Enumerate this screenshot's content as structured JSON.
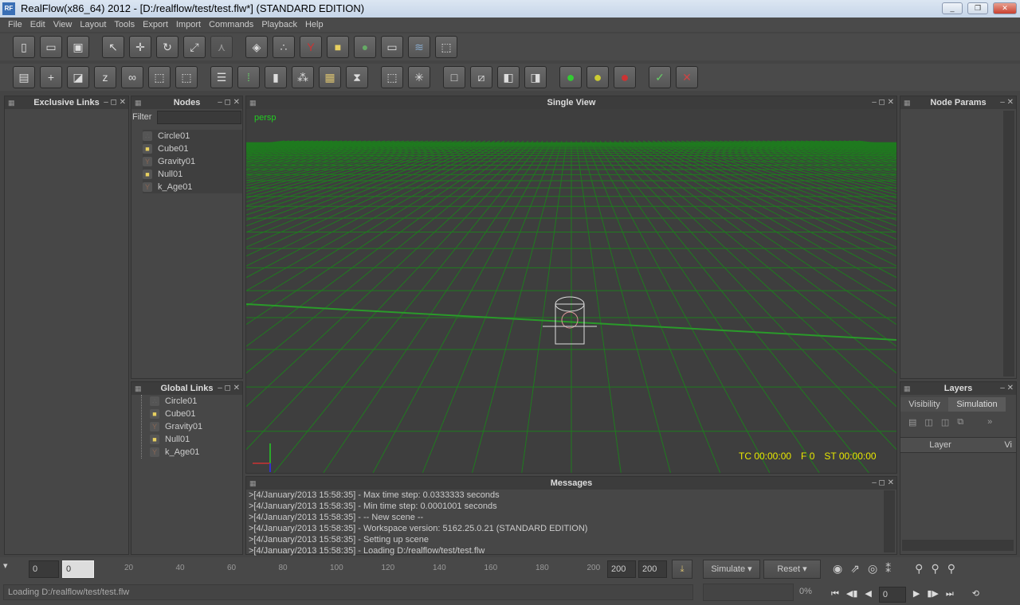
{
  "window": {
    "title": "RealFlow(x86_64) 2012 - [D:/realflow/test/test.flw*] (STANDARD EDITION)",
    "logo": "RF"
  },
  "menu": [
    "File",
    "Edit",
    "View",
    "Layout",
    "Tools",
    "Export",
    "Import",
    "Commands",
    "Playback",
    "Help"
  ],
  "panels": {
    "exclusive_links": {
      "title": "Exclusive Links"
    },
    "nodes": {
      "title": "Nodes",
      "filter_label": "Filter",
      "filter_value": "",
      "items": [
        {
          "label": "Circle01",
          "icon": "circle-emitter-icon"
        },
        {
          "label": "Cube01",
          "icon": "cube-icon"
        },
        {
          "label": "Gravity01",
          "icon": "gravity-icon"
        },
        {
          "label": "Null01",
          "icon": "null-icon"
        },
        {
          "label": "k_Age01",
          "icon": "k-age-icon"
        }
      ]
    },
    "global_links": {
      "title": "Global Links",
      "items": [
        "Circle01",
        "Cube01",
        "Gravity01",
        "Null01",
        "k_Age01"
      ]
    },
    "viewport": {
      "title": "Single View",
      "camera": "persp",
      "tc": "TC 00:00:00",
      "frame": "F 0",
      "st": "ST 00:00:00",
      "grid_color": "#1f7a1f",
      "hud_color": "#e8e800"
    },
    "messages": {
      "title": "Messages",
      "lines": [
        ">[4/January/2013 15:58:35] - Max time step: 0.0333333 seconds",
        ">[4/January/2013 15:58:35] - Min time step: 0.0001001 seconds",
        ">[4/January/2013 15:58:35] - -- New scene --",
        ">[4/January/2013 15:58:35] - Workspace version: 5162.25.0.21 (STANDARD EDITION)",
        ">[4/January/2013 15:58:35] - Setting up scene",
        ">[4/January/2013 15:58:35] -  Loading D:/realflow/test/test.flw"
      ]
    },
    "node_params": {
      "title": "Node Params"
    },
    "layers": {
      "title": "Layers",
      "tabs": [
        "Visibility",
        "Simulation"
      ],
      "columns": [
        "Layer",
        "Vi"
      ]
    }
  },
  "timeline": {
    "start": "0",
    "current": "0",
    "ticks": [
      "20",
      "40",
      "60",
      "80",
      "100",
      "120",
      "140",
      "160",
      "180",
      "200"
    ],
    "end1": "200",
    "end2": "200"
  },
  "simulate": {
    "simulate_label": "Simulate",
    "reset_label": "Reset",
    "progress": "0%"
  },
  "playback": {
    "frame": "0"
  },
  "status": {
    "text": "Loading D:/realflow/test/test.flw"
  }
}
